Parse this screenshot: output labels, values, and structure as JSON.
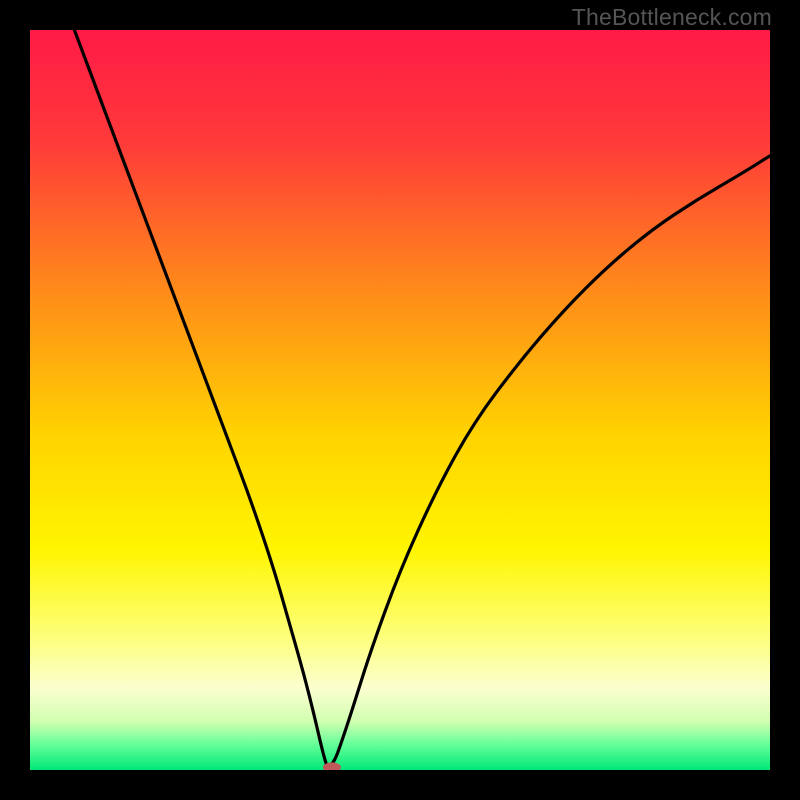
{
  "watermark": "TheBottleneck.com",
  "chart_data": {
    "type": "line",
    "title": "",
    "xlabel": "",
    "ylabel": "",
    "xlim": [
      0,
      100
    ],
    "ylim": [
      0,
      100
    ],
    "gradient_stops": [
      {
        "offset": 0,
        "color": "#ff1a47"
      },
      {
        "offset": 0.15,
        "color": "#ff3a3a"
      },
      {
        "offset": 0.35,
        "color": "#ff8a1a"
      },
      {
        "offset": 0.55,
        "color": "#ffd400"
      },
      {
        "offset": 0.7,
        "color": "#fff500"
      },
      {
        "offset": 0.82,
        "color": "#fdff7a"
      },
      {
        "offset": 0.89,
        "color": "#fbffd0"
      },
      {
        "offset": 0.935,
        "color": "#d0ffb0"
      },
      {
        "offset": 0.965,
        "color": "#66ff99"
      },
      {
        "offset": 1.0,
        "color": "#00e878"
      }
    ],
    "series": [
      {
        "name": "bottleneck-curve",
        "x": [
          6,
          9,
          12,
          15,
          18,
          21,
          24,
          27,
          30,
          33,
          35,
          37,
          38.5,
          39.3,
          39.9,
          40.2,
          40.4,
          41.2,
          42,
          43.5,
          46,
          50,
          55,
          60,
          66,
          72,
          78,
          84,
          90,
          96,
          100
        ],
        "y": [
          100,
          92,
          84,
          76,
          68,
          60,
          52,
          44,
          36,
          27,
          20,
          13,
          7,
          3.5,
          1.2,
          0.4,
          0.4,
          1.3,
          3.5,
          8,
          16,
          27,
          38,
          47,
          55,
          62,
          68,
          73,
          77,
          80.5,
          83
        ]
      }
    ],
    "marker": {
      "name": "optimal-point",
      "x": 40.8,
      "y": 0.35,
      "color": "#c05a5a",
      "rx": 9,
      "ry": 5
    }
  }
}
